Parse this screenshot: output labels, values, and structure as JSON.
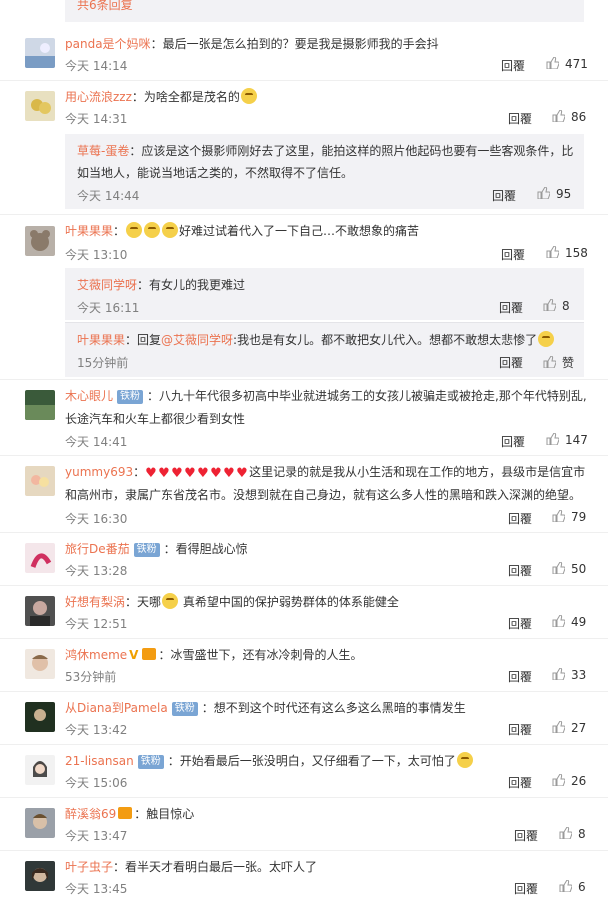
{
  "top": {
    "more_replies": "共6条回复"
  },
  "labels": {
    "reply": "回覆",
    "like_icon": "thumb-up-icon",
    "fan_badge": "铁粉"
  },
  "comments": [
    {
      "name": "panda是个妈咪",
      "text": "：最后一张是怎么拍到的？要是我是摄影师我的手会抖",
      "time": "今天 14:14",
      "likes": "471"
    },
    {
      "name": "用心流浪zzz",
      "text": "：为啥全都是茂名的",
      "time": "今天 14:31",
      "likes": "86"
    },
    {
      "name": "叶果果果",
      "text": "好难过试着代入了一下自己…不敢想象的痛苦",
      "time": "今天 13:10",
      "likes": "158"
    },
    {
      "name": "木心眼儿",
      "text1": "：八九十年代很多初高中毕业就进城务工的女孩儿被骗走或被抢走,那个年代特别乱,",
      "text2": "长途汽车和火车上都很少看到女性",
      "time": "今天 14:41",
      "likes": "147"
    },
    {
      "name": "yummy693",
      "text1": "这里记录的就是我从小生活和现在工作的地方，县级市是信宜市",
      "text2": "和高州市，隶属广东省茂名市。没想到就在自己身边，就有这么多人性的黑暗和跌入深渊的绝望。",
      "time": "今天 16:30",
      "likes": "79"
    },
    {
      "name": "旅行De番茄",
      "text": "：看得胆战心惊",
      "time": "今天 13:28",
      "likes": "50"
    },
    {
      "name": "好想有梨涡",
      "text1": "：天哪",
      "text2": "真希望中国的保护弱势群体的体系能健全",
      "time": "今天 12:51",
      "likes": "49"
    },
    {
      "name": "鸿休meme",
      "text": "：冰雪盛世下，还有冰冷刺骨的人生。",
      "time": "53分钟前",
      "likes": "33"
    },
    {
      "name": "从Diana到Pamela",
      "text": "：想不到这个时代还有这么多这么黑暗的事情发生",
      "time": "今天 13:42",
      "likes": "27"
    },
    {
      "name": "21-lisansan",
      "text": "：开始看最后一张没明白，又仔细看了一下，太可怕了",
      "time": "今天 15:06",
      "likes": "26"
    },
    {
      "name": "醉溪翁69",
      "text": "：触目惊心",
      "time": "今天 13:47",
      "likes": "8"
    },
    {
      "name": "叶子虫子",
      "text": "：看半天才看明白最后一张。太吓人了",
      "time": "今天 13:45",
      "likes": "6"
    }
  ],
  "subreplies": [
    {
      "name": "草莓-蛋卷",
      "text1": "：应该是这个摄影师刚好去了这里，能拍这样的照片他起码也要有一些客观条件，比",
      "text2": "如当地人，能说当地话之类的，不然取得不了信任。",
      "time": "今天 14:44",
      "likes": "95"
    },
    {
      "name": "艾薇同学呀",
      "text": "：有女儿的我更难过",
      "time": "今天 16:11",
      "likes": "8"
    },
    {
      "name": "叶果果果",
      "mid": "：回复",
      "mention": "@艾薇同学呀",
      "text": ":我也是有女儿。都不敢把女儿代入。想都不敢想太悲惨了",
      "time": "15分钟前",
      "likes": "赞"
    }
  ]
}
